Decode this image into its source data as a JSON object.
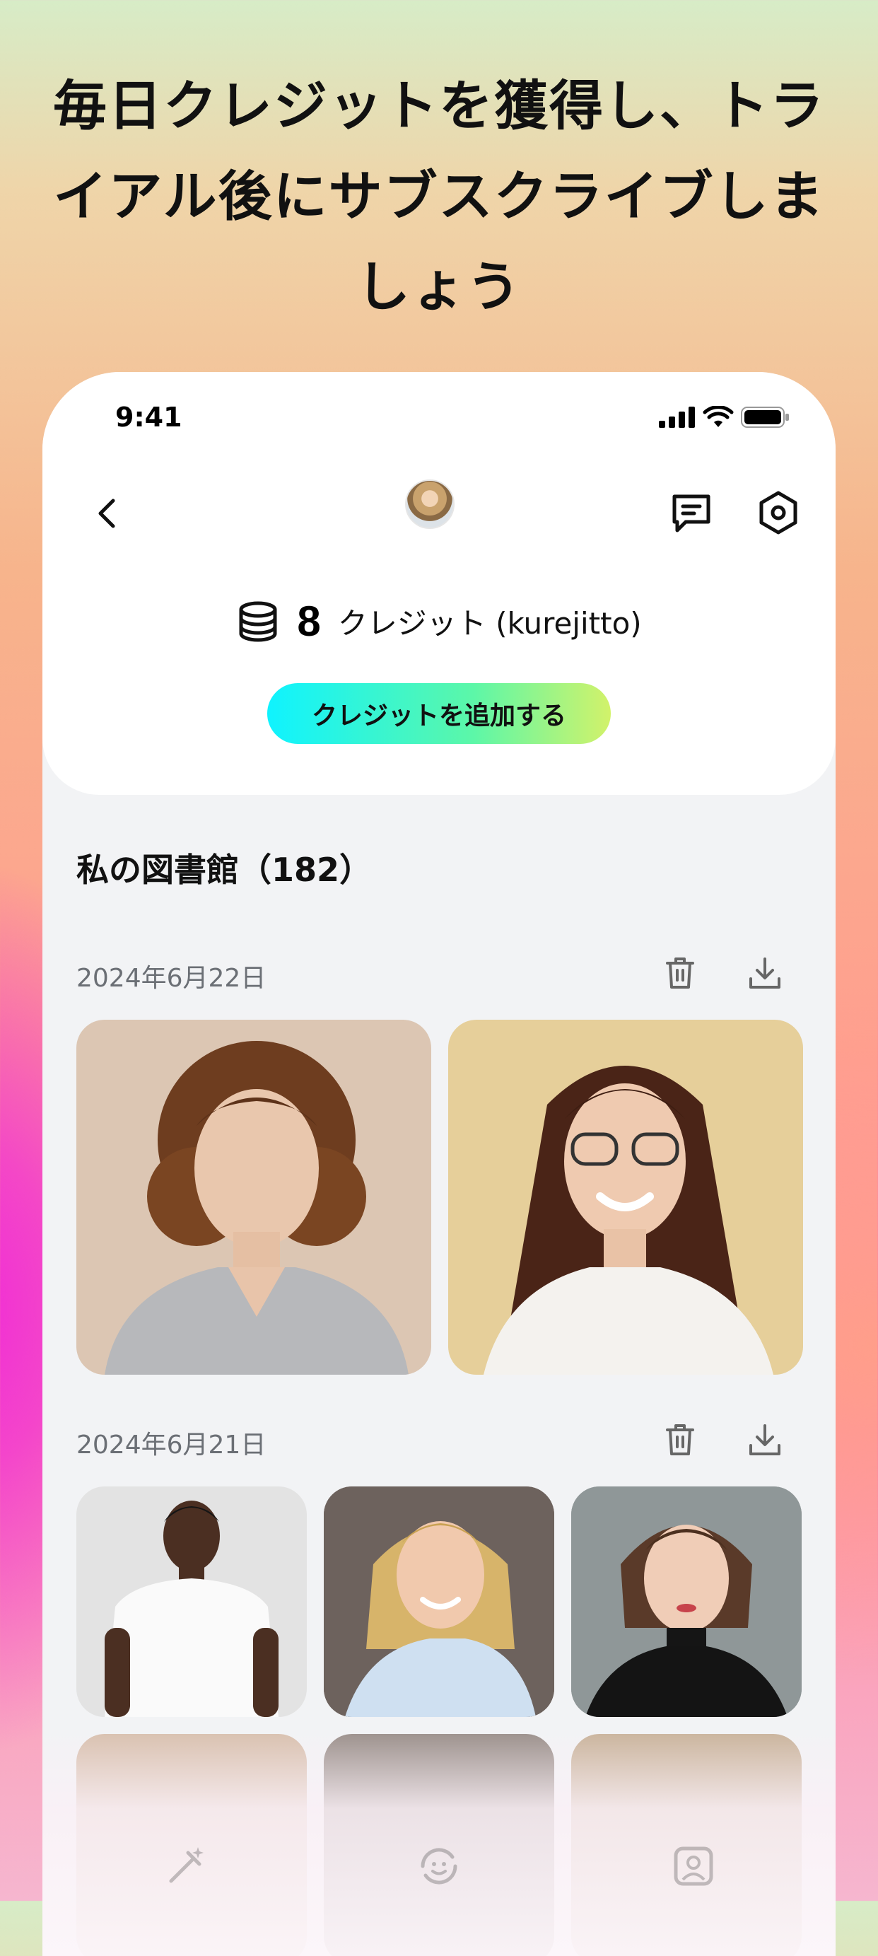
{
  "headline": [
    "毎日クレジットを獲得し、トラ",
    "イアル後にサブスクライブしま",
    "しょう"
  ],
  "status": {
    "time": "9:41"
  },
  "credits": {
    "count": "8",
    "label": "クレジット (kurejitto)",
    "add_button": "クレジットを追加する"
  },
  "library": {
    "title": "私の図書館（182）",
    "groups": [
      {
        "date": "2024年6月22日",
        "photos": [
          "portrait-curly-hair-woman",
          "portrait-smiling-woman-glasses"
        ]
      },
      {
        "date": "2024年6月21日",
        "photos": [
          "portrait-man-white-tshirt",
          "portrait-blonde-woman",
          "portrait-woman-black-turtleneck"
        ]
      }
    ]
  },
  "colors": {
    "accent_start": "#0ff3ff",
    "accent_end": "#d2f26a",
    "library_bg": "#f2f3f5"
  }
}
